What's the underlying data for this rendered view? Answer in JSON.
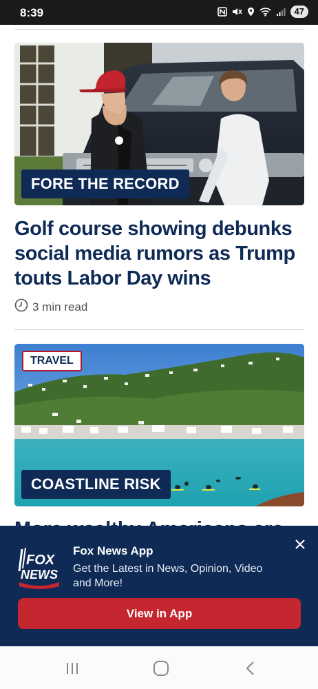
{
  "status_bar": {
    "time": "8:39",
    "battery": "47",
    "icons": [
      "nfc-icon",
      "mute-icon",
      "location-icon",
      "wifi-icon",
      "signal-icon",
      "battery-icon"
    ]
  },
  "articles": [
    {
      "kicker": "FORE THE RECORD",
      "headline": "Golf course showing debunks social media rumors as Trump touts Labor Day wins",
      "read_time": "3 min read",
      "read_time_icon": "clock-icon"
    },
    {
      "section_tag": "TRAVEL",
      "kicker": "COASTLINE RISK",
      "headline_partial": "More wealthy Americans are"
    }
  ],
  "promo": {
    "logo_line1": "FOX",
    "logo_line2": "NEWS",
    "title": "Fox News App",
    "subtitle": "Get the Latest in News, Opinion, Video and More!",
    "button_label": "View in App",
    "close_icon": "close-icon"
  },
  "nav_bar": {
    "items": [
      "recent-apps-icon",
      "home-icon",
      "back-icon"
    ]
  },
  "colors": {
    "navy": "#0e2a55",
    "red": "#c4272f",
    "status_bar": "#1a1a1a"
  }
}
